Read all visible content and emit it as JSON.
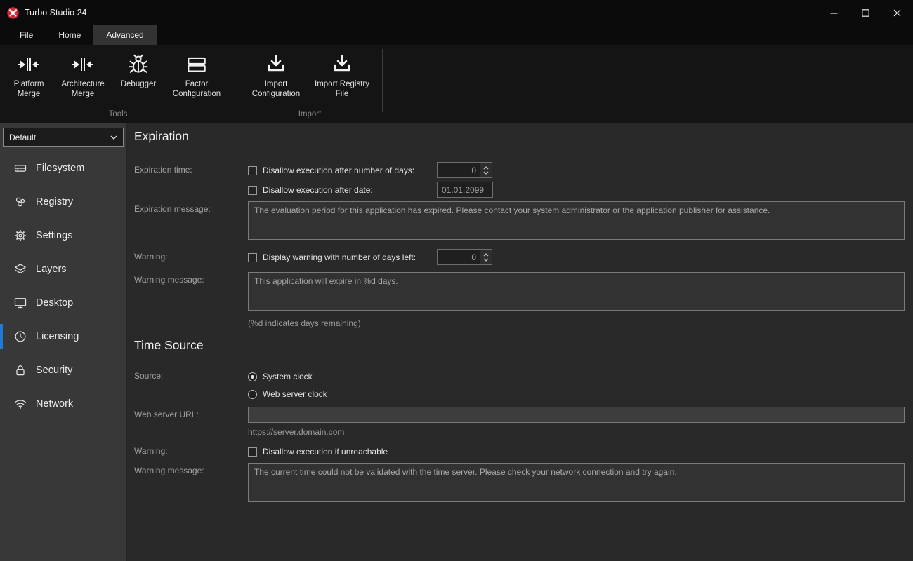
{
  "window": {
    "title": "Turbo Studio 24",
    "controls": {
      "minimize": "minimize-icon",
      "maximize": "maximize-icon",
      "close": "close-icon"
    }
  },
  "tabs": {
    "items": [
      {
        "label": "File"
      },
      {
        "label": "Home"
      },
      {
        "label": "Advanced"
      }
    ]
  },
  "ribbon": {
    "groups": [
      {
        "label": "Tools",
        "buttons": [
          {
            "label": "Platform Merge",
            "icon": "merge-icon"
          },
          {
            "label": "Architecture Merge",
            "icon": "merge-icon"
          },
          {
            "label": "Debugger",
            "icon": "bug-icon"
          },
          {
            "label": "Factor Configuration",
            "icon": "stacked-rects-icon"
          }
        ]
      },
      {
        "label": "Import",
        "buttons": [
          {
            "label": "Import Configuration",
            "icon": "download-icon"
          },
          {
            "label": "Import Registry File",
            "icon": "download-icon"
          }
        ]
      }
    ]
  },
  "sidebar": {
    "profile": {
      "value": "Default"
    },
    "items": [
      {
        "label": "Filesystem",
        "icon": "drive-icon"
      },
      {
        "label": "Registry",
        "icon": "registry-icon"
      },
      {
        "label": "Settings",
        "icon": "gear-icon"
      },
      {
        "label": "Layers",
        "icon": "layers-icon"
      },
      {
        "label": "Desktop",
        "icon": "monitor-icon"
      },
      {
        "label": "Licensing",
        "icon": "clock-icon",
        "active": true
      },
      {
        "label": "Security",
        "icon": "lock-icon"
      },
      {
        "label": "Network",
        "icon": "wifi-icon"
      }
    ]
  },
  "main": {
    "expiration": {
      "title": "Expiration",
      "expiration_time_label": "Expiration time:",
      "days_checkbox_label": "Disallow execution after number of days:",
      "days_value": "0",
      "date_checkbox_label": "Disallow execution after date:",
      "date_value": "01.01.2099",
      "message_label": "Expiration message:",
      "message_value": "The evaluation period for this application has expired. Please contact your system administrator or the application publisher for assistance.",
      "warning_label": "Warning:",
      "warning_checkbox_label": "Display warning with number of days left:",
      "warning_days_value": "0",
      "warning_message_label": "Warning message:",
      "warning_message_value": "This application will expire in %d days.",
      "warning_message_hint": "(%d indicates days remaining)"
    },
    "time_source": {
      "title": "Time Source",
      "source_label": "Source:",
      "radio_system_clock": "System clock",
      "radio_web_server_clock": "Web server clock",
      "web_server_url_label": "Web server URL:",
      "web_server_url_value": "",
      "web_server_url_hint": "https://server.domain.com",
      "warning_label": "Warning:",
      "warning_checkbox_label": "Disallow execution if unreachable",
      "warning_message_label": "Warning message:",
      "warning_message_value": "The current time could not be validated with the time server. Please check your network connection and try again."
    }
  }
}
